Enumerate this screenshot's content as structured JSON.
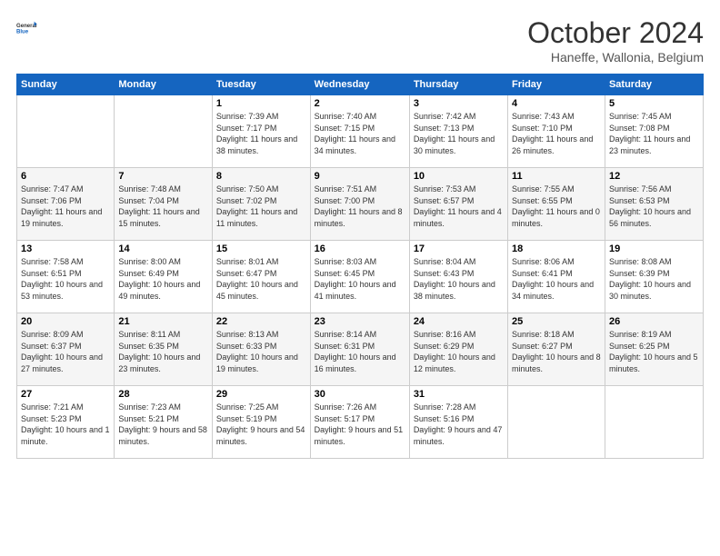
{
  "header": {
    "logo_general": "General",
    "logo_blue": "Blue",
    "month": "October 2024",
    "location": "Haneffe, Wallonia, Belgium"
  },
  "days_of_week": [
    "Sunday",
    "Monday",
    "Tuesday",
    "Wednesday",
    "Thursday",
    "Friday",
    "Saturday"
  ],
  "weeks": [
    [
      {
        "num": "",
        "info": ""
      },
      {
        "num": "",
        "info": ""
      },
      {
        "num": "1",
        "info": "Sunrise: 7:39 AM\nSunset: 7:17 PM\nDaylight: 11 hours\nand 38 minutes."
      },
      {
        "num": "2",
        "info": "Sunrise: 7:40 AM\nSunset: 7:15 PM\nDaylight: 11 hours\nand 34 minutes."
      },
      {
        "num": "3",
        "info": "Sunrise: 7:42 AM\nSunset: 7:13 PM\nDaylight: 11 hours\nand 30 minutes."
      },
      {
        "num": "4",
        "info": "Sunrise: 7:43 AM\nSunset: 7:10 PM\nDaylight: 11 hours\nand 26 minutes."
      },
      {
        "num": "5",
        "info": "Sunrise: 7:45 AM\nSunset: 7:08 PM\nDaylight: 11 hours\nand 23 minutes."
      }
    ],
    [
      {
        "num": "6",
        "info": "Sunrise: 7:47 AM\nSunset: 7:06 PM\nDaylight: 11 hours\nand 19 minutes."
      },
      {
        "num": "7",
        "info": "Sunrise: 7:48 AM\nSunset: 7:04 PM\nDaylight: 11 hours\nand 15 minutes."
      },
      {
        "num": "8",
        "info": "Sunrise: 7:50 AM\nSunset: 7:02 PM\nDaylight: 11 hours\nand 11 minutes."
      },
      {
        "num": "9",
        "info": "Sunrise: 7:51 AM\nSunset: 7:00 PM\nDaylight: 11 hours\nand 8 minutes."
      },
      {
        "num": "10",
        "info": "Sunrise: 7:53 AM\nSunset: 6:57 PM\nDaylight: 11 hours\nand 4 minutes."
      },
      {
        "num": "11",
        "info": "Sunrise: 7:55 AM\nSunset: 6:55 PM\nDaylight: 11 hours\nand 0 minutes."
      },
      {
        "num": "12",
        "info": "Sunrise: 7:56 AM\nSunset: 6:53 PM\nDaylight: 10 hours\nand 56 minutes."
      }
    ],
    [
      {
        "num": "13",
        "info": "Sunrise: 7:58 AM\nSunset: 6:51 PM\nDaylight: 10 hours\nand 53 minutes."
      },
      {
        "num": "14",
        "info": "Sunrise: 8:00 AM\nSunset: 6:49 PM\nDaylight: 10 hours\nand 49 minutes."
      },
      {
        "num": "15",
        "info": "Sunrise: 8:01 AM\nSunset: 6:47 PM\nDaylight: 10 hours\nand 45 minutes."
      },
      {
        "num": "16",
        "info": "Sunrise: 8:03 AM\nSunset: 6:45 PM\nDaylight: 10 hours\nand 41 minutes."
      },
      {
        "num": "17",
        "info": "Sunrise: 8:04 AM\nSunset: 6:43 PM\nDaylight: 10 hours\nand 38 minutes."
      },
      {
        "num": "18",
        "info": "Sunrise: 8:06 AM\nSunset: 6:41 PM\nDaylight: 10 hours\nand 34 minutes."
      },
      {
        "num": "19",
        "info": "Sunrise: 8:08 AM\nSunset: 6:39 PM\nDaylight: 10 hours\nand 30 minutes."
      }
    ],
    [
      {
        "num": "20",
        "info": "Sunrise: 8:09 AM\nSunset: 6:37 PM\nDaylight: 10 hours\nand 27 minutes."
      },
      {
        "num": "21",
        "info": "Sunrise: 8:11 AM\nSunset: 6:35 PM\nDaylight: 10 hours\nand 23 minutes."
      },
      {
        "num": "22",
        "info": "Sunrise: 8:13 AM\nSunset: 6:33 PM\nDaylight: 10 hours\nand 19 minutes."
      },
      {
        "num": "23",
        "info": "Sunrise: 8:14 AM\nSunset: 6:31 PM\nDaylight: 10 hours\nand 16 minutes."
      },
      {
        "num": "24",
        "info": "Sunrise: 8:16 AM\nSunset: 6:29 PM\nDaylight: 10 hours\nand 12 minutes."
      },
      {
        "num": "25",
        "info": "Sunrise: 8:18 AM\nSunset: 6:27 PM\nDaylight: 10 hours\nand 8 minutes."
      },
      {
        "num": "26",
        "info": "Sunrise: 8:19 AM\nSunset: 6:25 PM\nDaylight: 10 hours\nand 5 minutes."
      }
    ],
    [
      {
        "num": "27",
        "info": "Sunrise: 7:21 AM\nSunset: 5:23 PM\nDaylight: 10 hours\nand 1 minute."
      },
      {
        "num": "28",
        "info": "Sunrise: 7:23 AM\nSunset: 5:21 PM\nDaylight: 9 hours\nand 58 minutes."
      },
      {
        "num": "29",
        "info": "Sunrise: 7:25 AM\nSunset: 5:19 PM\nDaylight: 9 hours\nand 54 minutes."
      },
      {
        "num": "30",
        "info": "Sunrise: 7:26 AM\nSunset: 5:17 PM\nDaylight: 9 hours\nand 51 minutes."
      },
      {
        "num": "31",
        "info": "Sunrise: 7:28 AM\nSunset: 5:16 PM\nDaylight: 9 hours\nand 47 minutes."
      },
      {
        "num": "",
        "info": ""
      },
      {
        "num": "",
        "info": ""
      }
    ]
  ]
}
